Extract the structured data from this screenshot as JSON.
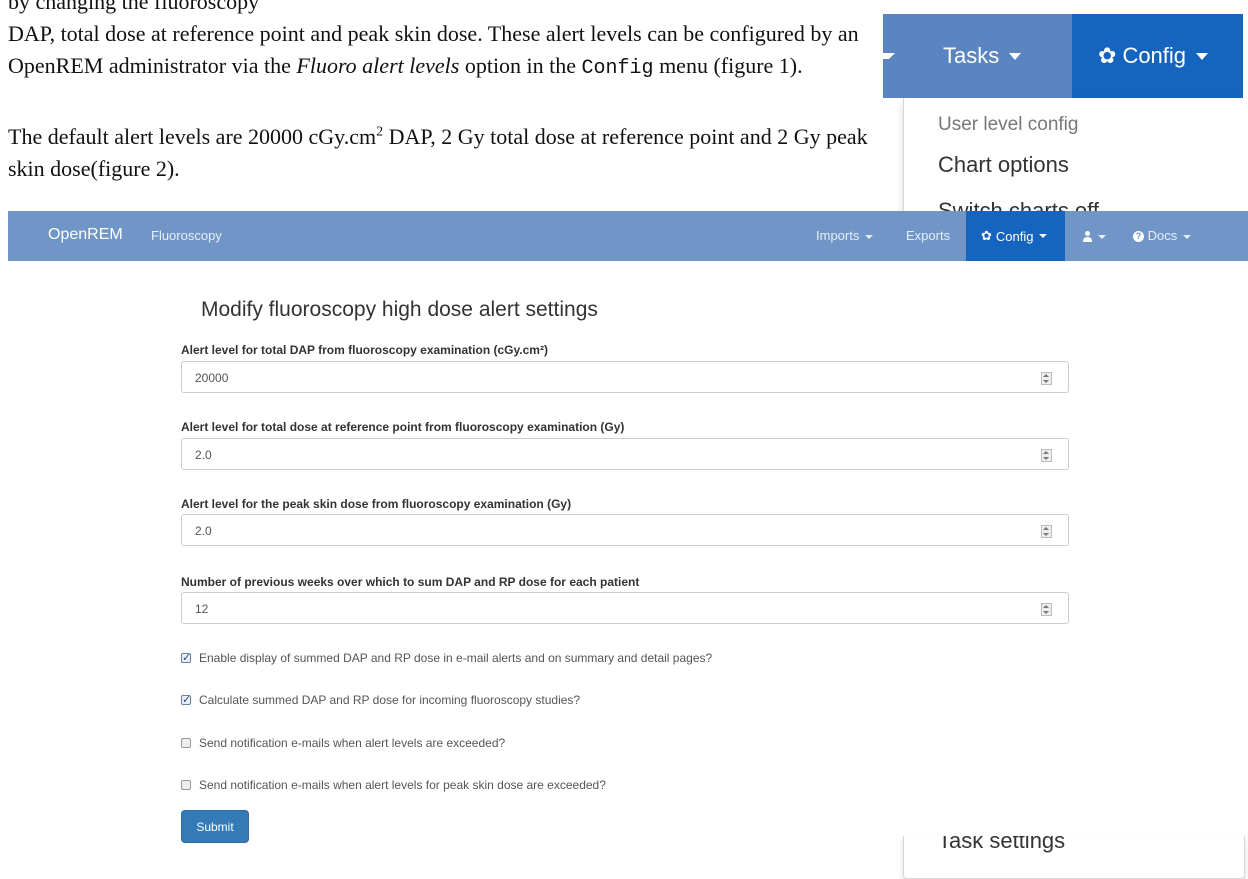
{
  "doc": {
    "p1_cutoff": "by changing the fluoroscopy",
    "p1_a": "DAP, total dose at reference point and peak skin dose. These alert levels can be configured by an OpenREM administrator via the ",
    "p1_em": "Fluoro alert levels",
    "p1_b": " option in the ",
    "p1_code": "Config",
    "p1_c": " menu (figure 1).",
    "p2_a": "The default alert levels are 20000 cGy.cm",
    "p2_sup": "2",
    "p2_b": " DAP, 2 Gy total dose at reference point and 2 Gy peak skin dose(figure 2)."
  },
  "figure1": {
    "tasks_label": "Tasks",
    "config_label": "Config",
    "menu_header": "User level config",
    "menu_item_1": "Chart options",
    "menu_item_2": "Switch charts off",
    "menu_item_last": "Task settings"
  },
  "navbar": {
    "brand": "OpenREM",
    "section": "Fluoroscopy",
    "imports": "Imports",
    "exports": "Exports",
    "config": "Config",
    "docs": "Docs"
  },
  "form": {
    "title": "Modify fluoroscopy high dose alert settings",
    "fields": [
      {
        "label": "Alert level for total DAP from fluoroscopy examination (cGy.cm²)",
        "value": "20000"
      },
      {
        "label": "Alert level for total dose at reference point from fluoroscopy examination (Gy)",
        "value": "2.0"
      },
      {
        "label": "Alert level for the peak skin dose from fluoroscopy examination (Gy)",
        "value": "2.0"
      },
      {
        "label": "Number of previous weeks over which to sum DAP and RP dose for each patient",
        "value": "12"
      }
    ],
    "checkboxes": [
      {
        "label": "Enable display of summed DAP and RP dose in e-mail alerts and on summary and detail pages?",
        "checked": true
      },
      {
        "label": "Calculate summed DAP and RP dose for incoming fluoroscopy studies?",
        "checked": true
      },
      {
        "label": "Send notification e-mails when alert levels are exceeded?",
        "checked": false
      },
      {
        "label": "Send notification e-mails when alert levels for peak skin dose are exceeded?",
        "checked": false
      }
    ],
    "submit_label": "Submit"
  }
}
